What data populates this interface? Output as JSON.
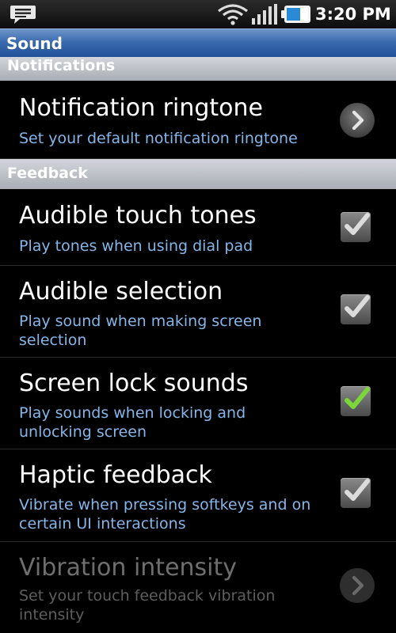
{
  "status_bar": {
    "time": "3:20 PM",
    "icons": [
      "message-icon",
      "wifi-icon",
      "signal-icon",
      "battery-icon"
    ]
  },
  "title_bar": {
    "title": "Sound"
  },
  "sections": {
    "notifications": "Notifications",
    "feedback": "Feedback"
  },
  "rows": [
    {
      "title": "Notification ringtone",
      "summary": "Set your default notification ringtone",
      "control": "chevron",
      "enabled": true
    },
    {
      "title": "Audible touch tones",
      "summary": "Play tones when using dial pad",
      "control": "checkbox",
      "checked": true,
      "enabled": true
    },
    {
      "title": "Audible selection",
      "summary": "Play sound when making screen selection",
      "control": "checkbox",
      "checked": true,
      "enabled": true
    },
    {
      "title": "Screen lock sounds",
      "summary": "Play sounds when locking and unlocking screen",
      "control": "checkbox",
      "checked": true,
      "enabled": true
    },
    {
      "title": "Haptic feedback",
      "summary": "Vibrate when pressing softkeys and on certain UI interactions",
      "control": "checkbox",
      "checked": true,
      "enabled": true
    },
    {
      "title": "Vibration intensity",
      "summary": "Set your touch feedback vibration intensity",
      "control": "chevron",
      "enabled": false
    }
  ],
  "colors": {
    "summary_text": "#86b5e8",
    "title_bar": "#3b6aae",
    "check_active": "#7bd63a",
    "check_inactive": "#d8d8d8"
  }
}
